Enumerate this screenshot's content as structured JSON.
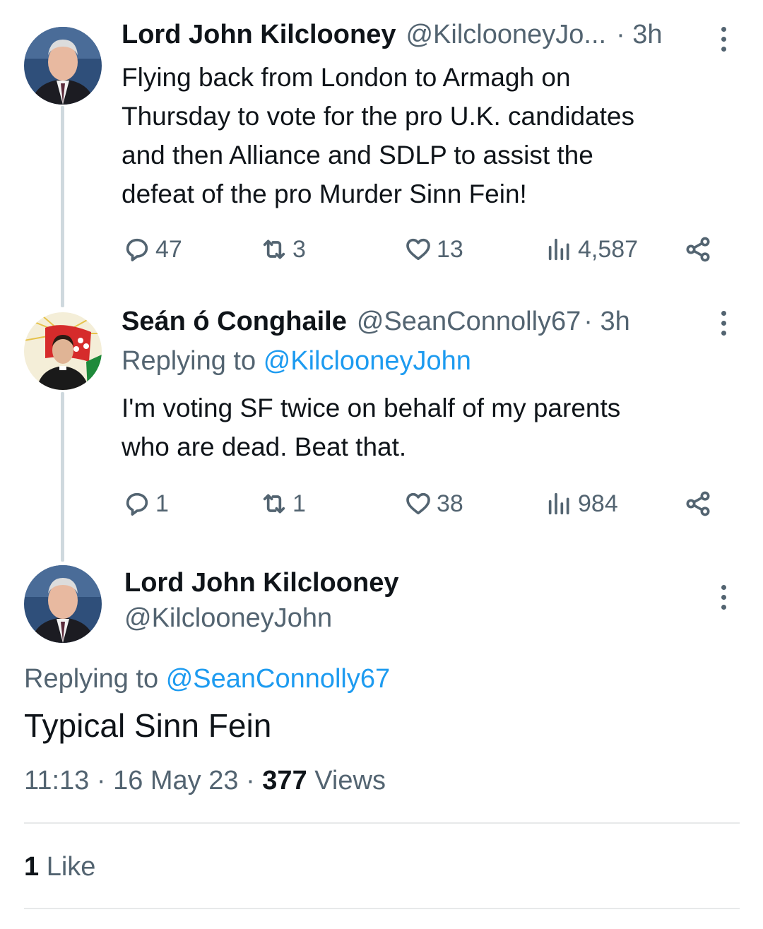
{
  "tweets": [
    {
      "name": "Lord John Kilclooney",
      "handle": "@KilclooneyJo...",
      "time": "· 3h",
      "text_lines": [
        "Flying back from London to Armagh on",
        "Thursday to vote for the pro U.K. candidates",
        "and then Alliance and SDLP to assist the",
        "defeat of the pro Murder Sinn Fein!"
      ],
      "stats": {
        "replies": "47",
        "retweets": "3",
        "likes": "13",
        "views": "4,587"
      }
    },
    {
      "name": "Seán ó Conghaile",
      "handle": "@SeanConnolly67",
      "time": "· 3h",
      "replying_prefix": "Replying to",
      "replying_to": "@KilclooneyJohn",
      "text_lines": [
        "I'm voting SF twice on behalf of my parents",
        "who are dead. Beat that."
      ],
      "stats": {
        "replies": "1",
        "retweets": "1",
        "likes": "38",
        "views": "984"
      }
    }
  ],
  "main": {
    "name": "Lord John Kilclooney",
    "handle": "@KilclooneyJohn",
    "replying_prefix": "Replying to",
    "replying_to": "@SeanConnolly67",
    "text": "Typical Sinn Fein",
    "time": "11:13",
    "date": "16 May 23",
    "views_count": "377",
    "views_label": "Views",
    "likes_count": "1",
    "likes_label": "Like"
  },
  "colors": {
    "link": "#1d9bf0",
    "secondary": "#536471",
    "primary": "#0f1419",
    "divider": "#e7e9ea"
  }
}
